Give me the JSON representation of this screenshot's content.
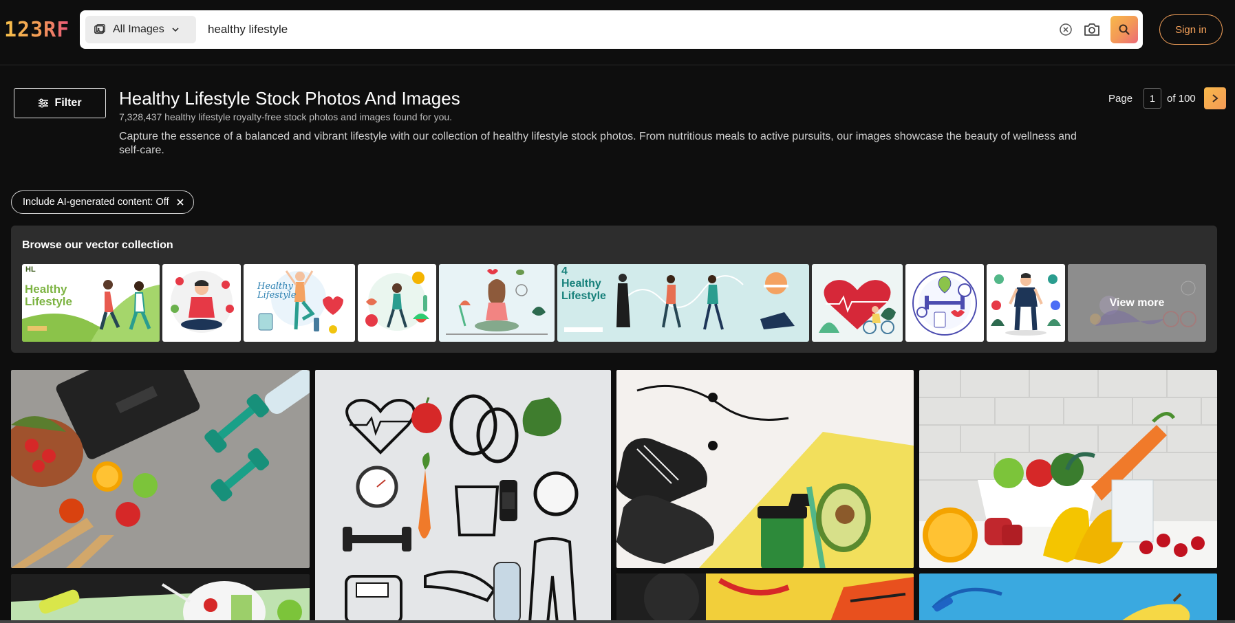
{
  "header": {
    "logo_text": "123RF",
    "search": {
      "type_label": "All Images",
      "query": "healthy lifestyle"
    },
    "signin_label": "Sign in"
  },
  "filter_label": "Filter",
  "title": "Healthy Lifestyle Stock Photos And Images",
  "result_count": "7,328,437 healthy lifestyle royalty-free stock photos and images found for you.",
  "description": "Capture the essence of a balanced and vibrant lifestyle with our collection of healthy lifestyle stock photos. From nutritious meals to active pursuits, our images showcase the beauty of wellness and self-care.",
  "pagination": {
    "page_label": "Page",
    "current_page": "1",
    "total_label": "of 100"
  },
  "ai_chip_label": "Include AI-generated content: Off",
  "vector_collection": {
    "title": "Browse our vector collection",
    "thumb1_logo": "HL",
    "thumb1_text": "Healthy Lifestyle",
    "thumb3_text": "Healthy Lifestyle",
    "thumb6_number": "4",
    "thumb6_text": "Healthy Lifestyle",
    "view_more_label": "View more"
  },
  "accent_colors": {
    "brand_gradient_start": "#f8c24a",
    "brand_gradient_end": "#e9567a",
    "signin_border": "#f6a25a",
    "background": "#0e0e0e",
    "panel": "#2d2d2d"
  },
  "icons": [
    "image-icon",
    "chevron-down-icon",
    "clear-icon",
    "camera-icon",
    "search-icon",
    "filter-icon",
    "chevron-right-icon",
    "close-icon"
  ]
}
